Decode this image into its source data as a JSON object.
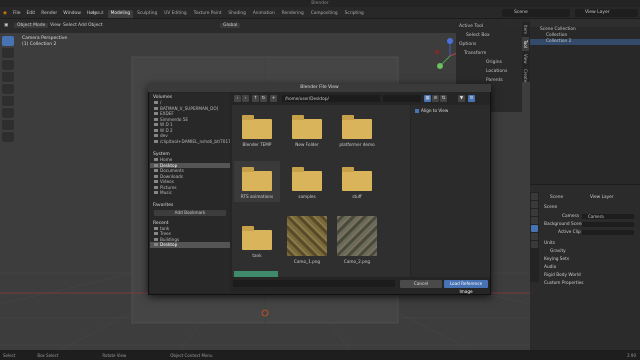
{
  "window": {
    "title": "Blender"
  },
  "menu": [
    "File",
    "Edit",
    "Render",
    "Window",
    "Help"
  ],
  "workspaces": {
    "tabs": [
      "Layout",
      "Modeling",
      "Sculpting",
      "UV Editing",
      "Texture Paint",
      "Shading",
      "Animation",
      "Rendering",
      "Compositing",
      "Scripting"
    ],
    "active": "Modeling"
  },
  "scene": {
    "scene_name": "Scene",
    "view_layer": "View Layer"
  },
  "header3d": {
    "mode": "Object Mode",
    "menus": [
      "View",
      "Select",
      "Add",
      "Object"
    ],
    "transform_orientation": "Global",
    "options_label": "Options"
  },
  "viewport": {
    "line1": "Camera Perspective",
    "line2": "(1) Collection 2"
  },
  "npanel": {
    "active_tool": "Active Tool",
    "select_box": "Select Box",
    "options": "Options",
    "transform": "Transform",
    "origins": "Origins",
    "locations": "Locations",
    "parents": "Parents",
    "tabs": [
      "Item",
      "Tool",
      "View",
      "Create"
    ]
  },
  "outliner": {
    "rows": [
      "Scene Collection",
      "Collection",
      "Collection 2"
    ],
    "selected": "Collection 2"
  },
  "properties": {
    "title_scene": "Scene",
    "title_layer": "View Layer",
    "section": "Scene",
    "camera_label": "Camera",
    "camera_value": "Camera",
    "bg_scene": "Background Scene",
    "active_clip": "Active Clip",
    "panels": [
      "Units",
      "Gravity",
      "Keying Sets",
      "Audio",
      "Rigid Body World",
      "Custom Properties"
    ]
  },
  "dialog": {
    "title": "Blender File View",
    "path": "/home/user/Desktop/",
    "volumes_header": "Volumes",
    "volumes": [
      "/",
      "BATMAN_V_SUPERMAN_DO]",
      "EXDEF",
      "Simmerdo 5E",
      "W D 1",
      "W D 2",
      "dev",
      "/clip/tool+DAMIEL_nshoti_bt/70177/ca"
    ],
    "system_header": "System",
    "system": [
      "Home",
      "Desktop",
      "Documents",
      "Downloads",
      "Videos",
      "Pictures",
      "Music"
    ],
    "system_selected": "Desktop",
    "favorites_header": "Favorites",
    "add_bookmark": "Add Bookmark",
    "recent_header": "Recent",
    "recent": [
      "tank",
      "Trees",
      "Buildings",
      "Desktop"
    ],
    "recent_selected": "Desktop",
    "files": [
      {
        "name": "Blender TEMP",
        "kind": "folder"
      },
      {
        "name": "New Folder",
        "kind": "folder"
      },
      {
        "name": "platformer demo",
        "kind": "folder"
      },
      {
        "name": "RTS animations",
        "kind": "folder"
      },
      {
        "name": "samples",
        "kind": "folder"
      },
      {
        "name": "stuff",
        "kind": "folder"
      },
      {
        "name": "tank",
        "kind": "folder"
      },
      {
        "name": "Camo_1.png",
        "kind": "image"
      },
      {
        "name": "Camo_2.png",
        "kind": "image"
      }
    ],
    "align_to_view": "Align to View",
    "cancel": "Cancel",
    "load": "Load Reference Image"
  },
  "status": {
    "items": [
      "Select",
      "Box Select",
      "Rotate View",
      "Object Context Menu"
    ],
    "version": "2.90"
  },
  "colors": {
    "accent": "#4772b3",
    "folder": "#d9b45a",
    "viewport": "#3d3d3d"
  }
}
